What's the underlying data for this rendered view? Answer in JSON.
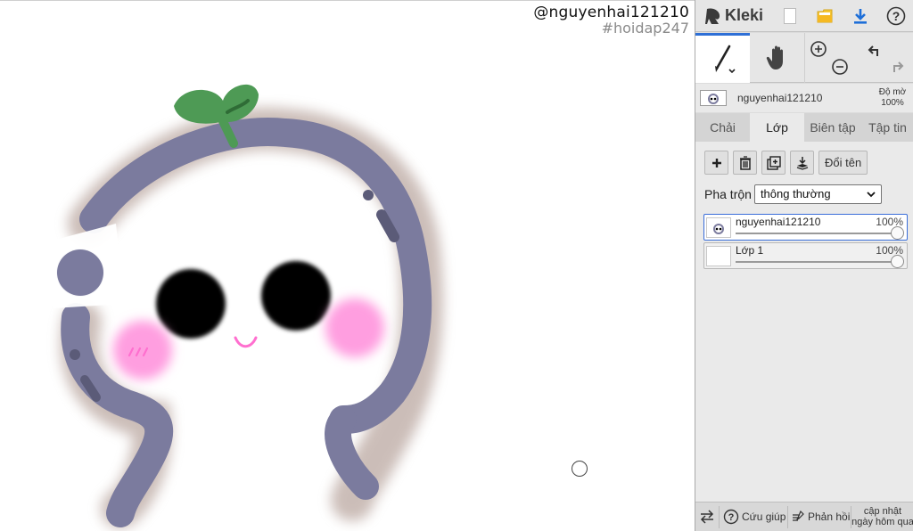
{
  "watermark": {
    "handle": "@nguyenhai121210",
    "tag": "#hoidap247"
  },
  "app": {
    "name": "Kleki",
    "accent_color": "#2e6fd6"
  },
  "topbar_icons": [
    "new-file-icon",
    "open-folder-icon",
    "download-icon",
    "help-icon"
  ],
  "tools": [
    "brush-tool-icon",
    "hand-tool-icon",
    "zoom-in-icon",
    "zoom-out-icon",
    "undo-icon",
    "redo-icon"
  ],
  "current_layer": {
    "name": "nguyenhai121210",
    "opacity_label": "Độ mờ",
    "opacity_value": "100%"
  },
  "tabs": {
    "brush": "Chải",
    "layer": "Lớp",
    "edit": "Biên tập",
    "file": "Tập tin"
  },
  "layer_panel": {
    "rename": "Đổi tên",
    "blend_label": "Pha trộn",
    "blend_mode": "thông thường",
    "layers": [
      {
        "name": "nguyenhai121210",
        "opacity": "100%",
        "selected": true
      },
      {
        "name": "Lớp 1",
        "opacity": "100%",
        "selected": false
      }
    ]
  },
  "bottombar": {
    "help": "Cứu giúp",
    "feedback": "Phản hồi",
    "update_line1": "cập nhật",
    "update_line2": "ngày hôm qua"
  },
  "colors": {
    "creature_body": "#7b7b9e",
    "leaf": "#4e9a55",
    "blush": "#ff9ee0"
  }
}
